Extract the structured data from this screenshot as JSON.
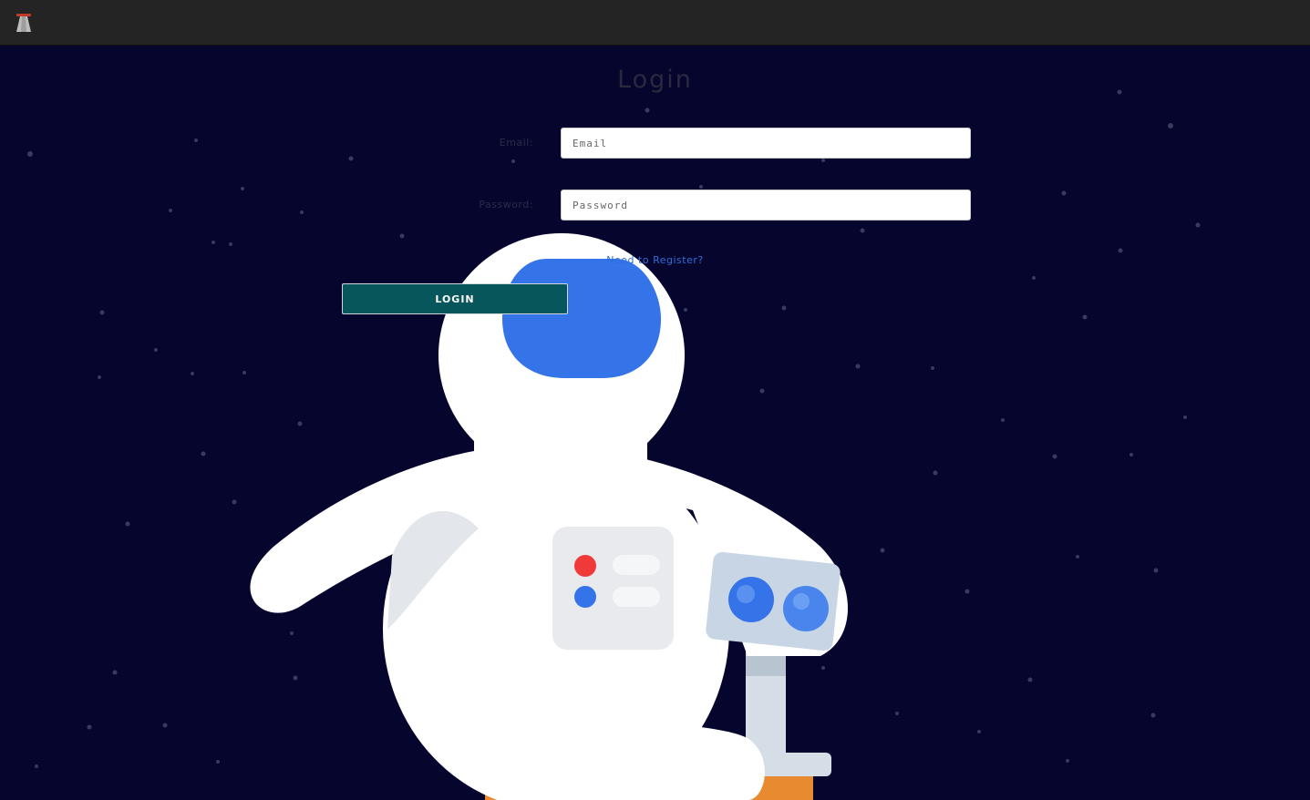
{
  "app": {
    "logo_icon": "rocket-icon"
  },
  "login": {
    "title": "Login",
    "email_label": "Email:",
    "email_placeholder": "Email",
    "email_value": "",
    "password_label": "Password:",
    "password_placeholder": "Password",
    "password_value": "",
    "register_link": "Need to Register?",
    "submit_label": "LOGIN"
  },
  "colors": {
    "background": "#05052e",
    "navbar": "#242424",
    "button": "#06565b",
    "link": "#2d6fd8",
    "visor": "#3574e8"
  },
  "illustration": "astronaut-illustration"
}
